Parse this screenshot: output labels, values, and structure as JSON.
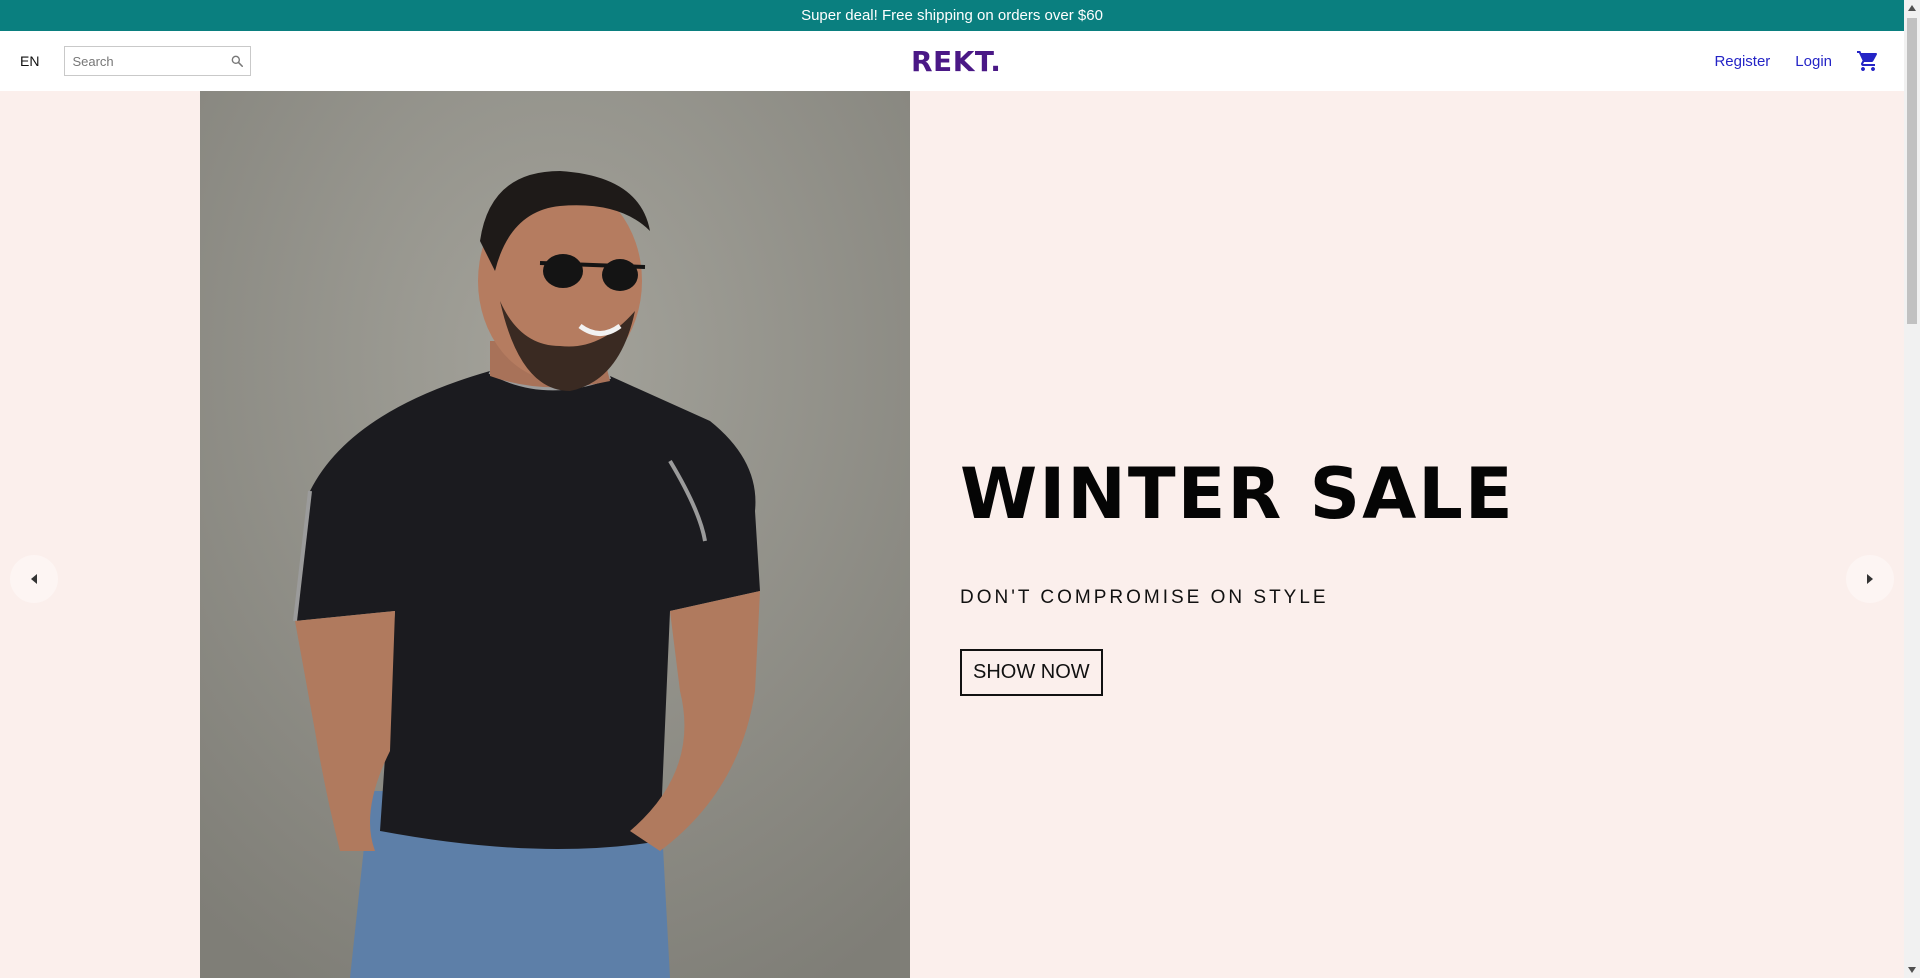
{
  "announcement": {
    "text": "Super deal! Free shipping on orders over $60"
  },
  "navbar": {
    "language": "EN",
    "search": {
      "placeholder": "Search",
      "value": ""
    },
    "logo": "REKT.",
    "register_label": "Register",
    "login_label": "Login"
  },
  "slide": {
    "title": "WINTER SALE",
    "description": "DON'T COMPROMISE ON STYLE",
    "button_label": "SHOW NOW",
    "image_alt_name": "man-in-black-tshirt-photo"
  },
  "colors": {
    "announcement_bg": "#0a7f7f",
    "logo": "#4a1886",
    "link": "#2424c6",
    "slide_bg": "#fbefec"
  },
  "icons": {
    "search": "search-icon",
    "cart": "shopping-cart-icon",
    "arrow_left": "arrow-left-icon",
    "arrow_right": "arrow-right-icon"
  }
}
